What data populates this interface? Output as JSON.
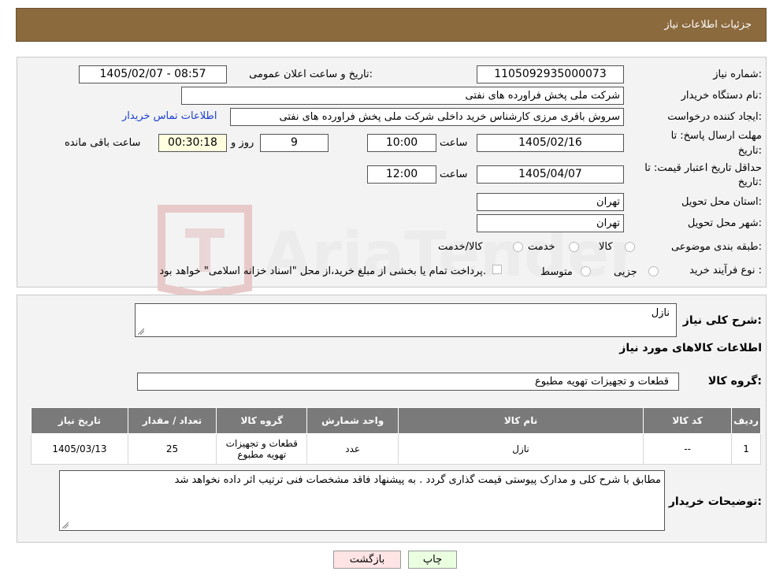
{
  "header": {
    "title": "جزئیات اطلاعات نیاز"
  },
  "form": {
    "need_number_label": "شماره نیاز:",
    "need_number": "1105092935000073",
    "announce_label": "تاریخ و ساعت اعلان عمومی:",
    "announce_value": "1405/02/07 - 08:57",
    "buyer_org_label": "نام دستگاه خریدار:",
    "buyer_org": "شرکت ملی پخش فراورده های نفتی",
    "creator_label": "ایجاد کننده درخواست:",
    "creator": "سروش باقری مرزی کارشناس خرید داخلی شرکت ملی پخش فراورده های نفتی",
    "contact_link": "اطلاعات تماس خریدار",
    "deadline_label_1": "مهلت ارسال پاسخ: تا",
    "deadline_label_2": "تاریخ:",
    "deadline_date": "1405/02/16",
    "time_label": "ساعت",
    "deadline_time": "10:00",
    "days_value": "9",
    "days_label": "روز و",
    "remaining_value": "00:30:18",
    "remaining_label": "ساعت باقی مانده",
    "validity_label_1": "حداقل تاریخ اعتبار قیمت: تا",
    "validity_label_2": "تاریخ:",
    "validity_date": "1405/04/07",
    "validity_time": "12:00",
    "province_label": "استان محل تحویل:",
    "province": "تهران",
    "city_label": "شهر محل تحویل:",
    "city": "تهران",
    "category_label": "طبقه بندی موضوعی:",
    "category_options": [
      "کالا",
      "خدمت",
      "کالا/خدمت"
    ],
    "process_label": "نوع فرآیند خرید :",
    "process_options": [
      "جزیی",
      "متوسط"
    ],
    "process_note": "پرداخت تمام یا بخشی از مبلغ خرید،از محل \"اسناد خزانه اسلامی\" خواهد بود."
  },
  "details": {
    "summary_label": "شرح کلی نیاز:",
    "summary_value": "نازل",
    "goods_info_title": "اطلاعات کالاهای مورد نیاز",
    "goods_group_label": "گروه کالا:",
    "goods_group_value": "قطعات و تجهیزات تهویه مطبوع",
    "table": {
      "headers": [
        "ردیف",
        "کد کالا",
        "نام کالا",
        "واحد شمارش",
        "گروه کالا",
        "تعداد / مقدار",
        "تاریخ نیاز"
      ],
      "rows": [
        [
          "1",
          "--",
          "نازل",
          "عدد",
          "قطعات و تجهیزات تهویه مطبوع",
          "25",
          "1405/03/13"
        ]
      ]
    },
    "buyer_notes_label": "توضیحات خریدار:",
    "buyer_notes_value": "مطابق با شرح کلی و مدارک پیوستی قیمت گذاری گردد . به پیشنهاد فاقد مشخصات فنی ترتیب اثر داده نخواهد شد"
  },
  "buttons": {
    "print": "چاپ",
    "back": "بازگشت"
  },
  "colors": {
    "header_bg": "#8b6a3e",
    "print_btn": "#eaffe0",
    "back_btn": "#ffe4e4",
    "link": "#1a3fd0"
  }
}
